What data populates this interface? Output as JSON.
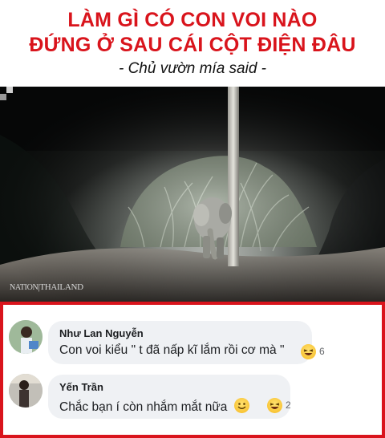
{
  "header": {
    "title_line1": "LÀM GÌ CÓ CON VOI NÀO",
    "title_line2": "ĐỨNG Ở SAU CÁI CỘT ĐIỆN ĐÂU",
    "subtitle": "- Chủ vườn mía said -"
  },
  "photo": {
    "watermark": "NATION THAILAND",
    "watermark_brand": "NATION",
    "watermark_suffix": "THAILAND"
  },
  "comments": [
    {
      "author": "Như Lan Nguyễn",
      "text": "Con voi kiểu \" t đã nấp kĩ lắm rồi cơ mà \"",
      "reactions": [
        "laughing-emoji"
      ],
      "reaction_count": "6"
    },
    {
      "author": "Yến Trần",
      "text": "Chắc bạn í còn nhắm mắt nữa",
      "inline_emoji": "smiling-emoji",
      "reactions": [
        "laughing-emoji"
      ],
      "reaction_count": "2"
    }
  ],
  "colors": {
    "title_red": "#d9141c",
    "frame_red": "#d9141c",
    "bubble_gray": "#eff1f4"
  }
}
